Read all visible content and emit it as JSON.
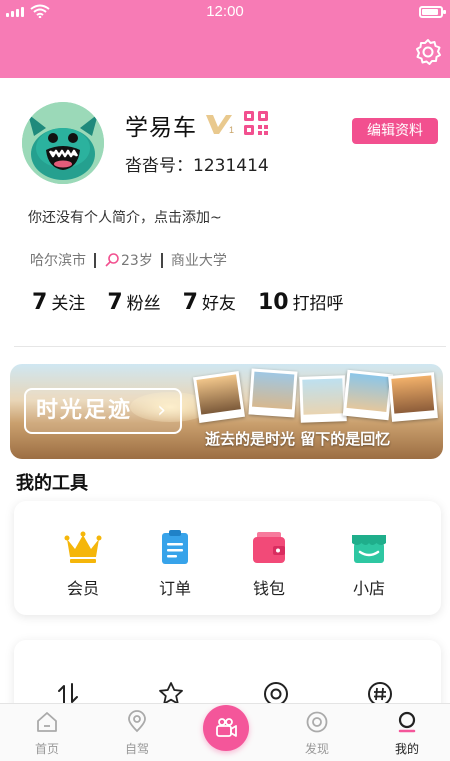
{
  "status_bar": {
    "time": "12:00"
  },
  "profile": {
    "username": "学易车",
    "vip_label": "V",
    "id_label": "沓沓号：",
    "id_value": "1231414",
    "edit_button": "编辑资料",
    "bio": "你还没有个人简介，点击添加~",
    "city": "哈尔滨市",
    "age": "23岁",
    "school": "商业大学"
  },
  "stats": [
    {
      "num": "7",
      "label": "关注"
    },
    {
      "num": "7",
      "label": "粉丝"
    },
    {
      "num": "7",
      "label": "好友"
    },
    {
      "num": "10",
      "label": "打招呼"
    }
  ],
  "banner": {
    "button_label": "时光足迹",
    "arrow": "›",
    "caption": "逝去的是时光 留下的是回忆"
  },
  "tools": {
    "title": "我的工具",
    "items": [
      {
        "label": "会员",
        "icon": "crown-icon",
        "color": "#f5b60a"
      },
      {
        "label": "订单",
        "icon": "order-icon",
        "color": "#37a3ea"
      },
      {
        "label": "钱包",
        "icon": "wallet-icon",
        "color": "#f24a78"
      },
      {
        "label": "小店",
        "icon": "shop-icon",
        "color": "#2ec7a2"
      }
    ]
  },
  "tabbar": {
    "items": [
      {
        "label": "首页",
        "icon": "home-icon"
      },
      {
        "label": "自驾",
        "icon": "map-pin-icon"
      },
      {
        "label": "",
        "icon": "video-camera-icon"
      },
      {
        "label": "发现",
        "icon": "discover-icon"
      },
      {
        "label": "我的",
        "icon": "profile-icon"
      }
    ],
    "active": "我的"
  },
  "colors": {
    "accent": "#f77bb5",
    "button": "#f2508f",
    "center_button": "#f4569a"
  }
}
